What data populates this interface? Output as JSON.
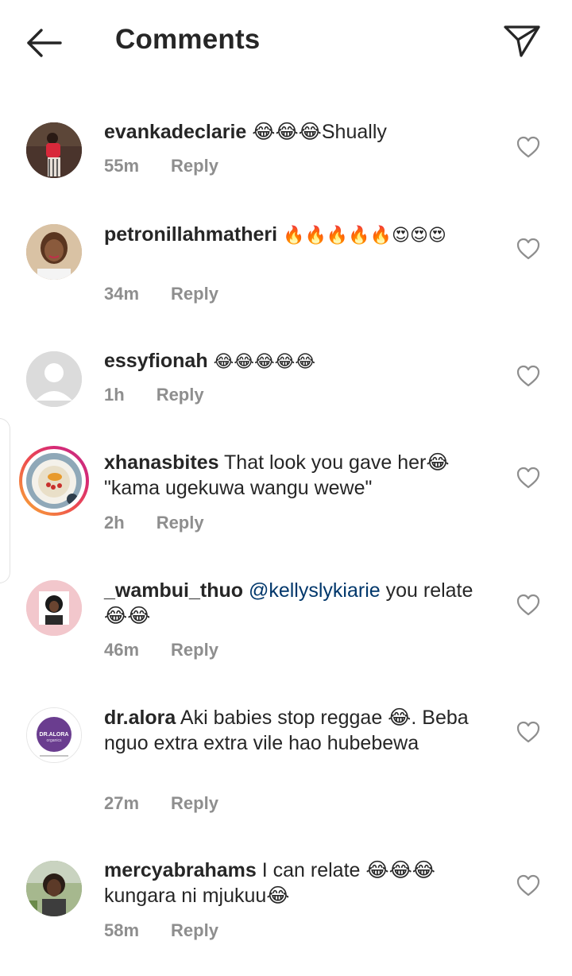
{
  "header": {
    "title": "Comments"
  },
  "comments": [
    {
      "username": "evankadeclarie",
      "text": "😂😂😂Shually",
      "time": "55m",
      "reply": "Reply"
    },
    {
      "username": "petronillahmatheri",
      "text": "🔥🔥🔥🔥🔥😍😍😍",
      "time": "34m",
      "reply": "Reply"
    },
    {
      "username": "essyfionah",
      "text": "😂😂😂😂😂",
      "time": "1h",
      "reply": "Reply"
    },
    {
      "username": "xhanasbites",
      "text": "That look you gave her😂 \"kama ugekuwa wangu wewe\"",
      "time": "2h",
      "reply": "Reply"
    },
    {
      "username": "_wambui_thuo",
      "mention": "@kellyslykiarie",
      "text": "you relate😂😂",
      "time": "46m",
      "reply": "Reply"
    },
    {
      "username": "dr.alora",
      "text": "Aki babies stop reggae 😂. Beba nguo extra extra vile hao hubebewa",
      "time": "27m",
      "reply": "Reply",
      "avatar_text": "DR.ALORA",
      "avatar_subtext": "organics"
    },
    {
      "username": "mercyabrahams",
      "text": "I can relate 😂😂😂 kungara ni mjukuu😂",
      "time": "58m",
      "reply": "Reply"
    }
  ]
}
